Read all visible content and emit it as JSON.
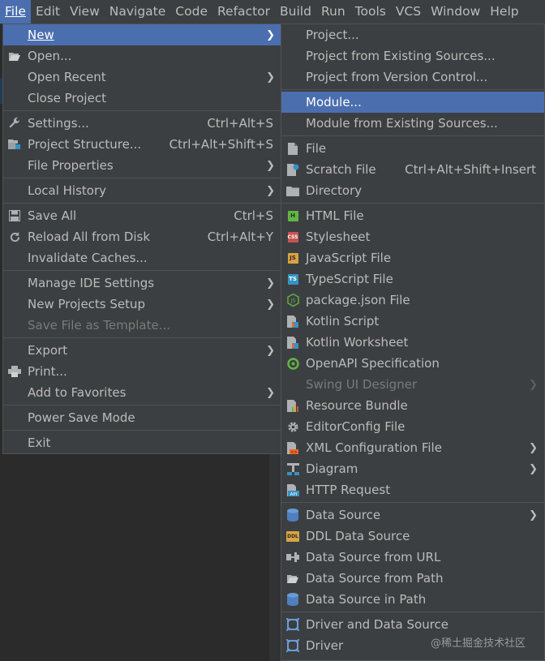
{
  "menubar": [
    "File",
    "Edit",
    "View",
    "Navigate",
    "Code",
    "Refactor",
    "Build",
    "Run",
    "Tools",
    "VCS",
    "Window",
    "Help"
  ],
  "file_menu": {
    "new": "New",
    "open": "Open...",
    "open_recent": "Open Recent",
    "close_project": "Close Project",
    "settings": "Settings...",
    "settings_sc": "Ctrl+Alt+S",
    "project_structure": "Project Structure...",
    "project_structure_sc": "Ctrl+Alt+Shift+S",
    "file_properties": "File Properties",
    "local_history": "Local History",
    "save_all": "Save All",
    "save_all_sc": "Ctrl+S",
    "reload": "Reload All from Disk",
    "reload_sc": "Ctrl+Alt+Y",
    "invalidate": "Invalidate Caches...",
    "manage_ide": "Manage IDE Settings",
    "new_projects_setup": "New Projects Setup",
    "save_template": "Save File as Template...",
    "export": "Export",
    "print": "Print...",
    "add_favorites": "Add to Favorites",
    "power_save": "Power Save Mode",
    "exit": "Exit"
  },
  "new_menu": {
    "project": "Project...",
    "project_existing": "Project from Existing Sources...",
    "project_vcs": "Project from Version Control...",
    "module": "Module...",
    "module_existing": "Module from Existing Sources...",
    "file": "File",
    "scratch": "Scratch File",
    "scratch_sc": "Ctrl+Alt+Shift+Insert",
    "directory": "Directory",
    "html": "HTML File",
    "stylesheet": "Stylesheet",
    "js": "JavaScript File",
    "ts": "TypeScript File",
    "pkg": "package.json File",
    "kotlin_script": "Kotlin Script",
    "kotlin_ws": "Kotlin Worksheet",
    "openapi": "OpenAPI Specification",
    "swing": "Swing UI Designer",
    "resource": "Resource Bundle",
    "editorconfig": "EditorConfig File",
    "xml": "XML Configuration File",
    "diagram": "Diagram",
    "http": "HTTP Request",
    "datasource": "Data Source",
    "ddl": "DDL Data Source",
    "ds_url": "Data Source from URL",
    "ds_path": "Data Source from Path",
    "ds_in_path": "Data Source in Path",
    "driver_ds": "Driver and Data Source",
    "driver": "Driver"
  },
  "watermark": "@稀土掘金技术社区",
  "colors": {
    "menu_bg": "#3c3f41",
    "selection": "#4b6eaf",
    "text": "#bbbbbb",
    "disabled": "#7a7a7a"
  }
}
